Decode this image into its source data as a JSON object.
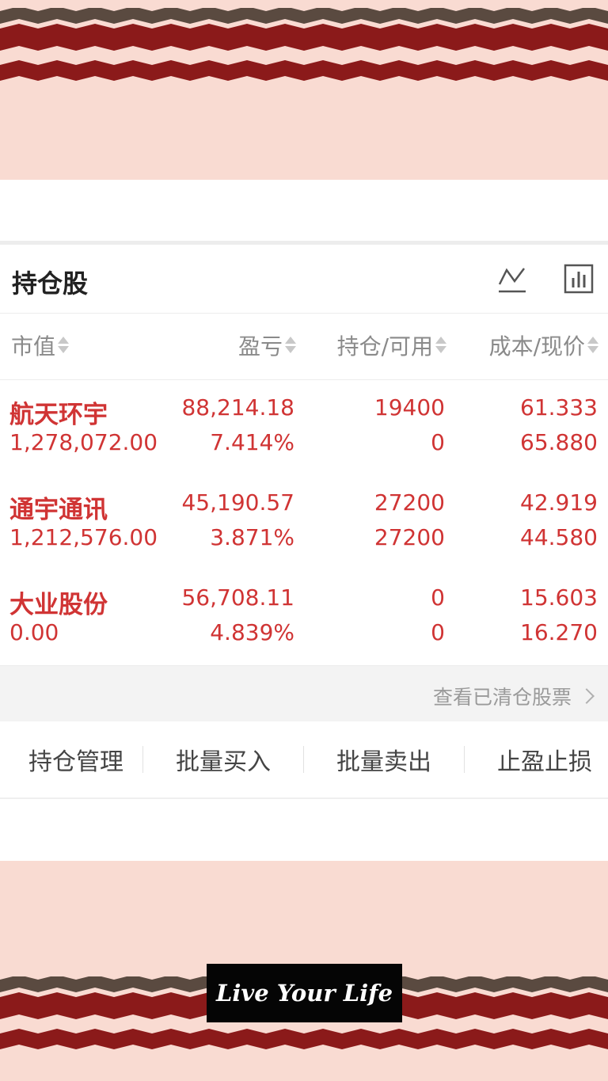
{
  "section": {
    "title": "持仓股"
  },
  "icons": {
    "trend": "line-chart-icon",
    "bars": "bar-chart-icon",
    "chevron": "chevron-right-icon"
  },
  "columns": [
    "市值",
    "盈亏",
    "持仓/可用",
    "成本/现价"
  ],
  "stocks": [
    {
      "name": "航天环宇",
      "market_value": "1,278,072.00",
      "pnl": "88,214.18",
      "pnl_pct": "7.414%",
      "position": "19400",
      "available": "0",
      "cost": "61.333",
      "price": "65.880"
    },
    {
      "name": "通宇通讯",
      "market_value": "1,212,576.00",
      "pnl": "45,190.57",
      "pnl_pct": "3.871%",
      "position": "27200",
      "available": "27200",
      "cost": "42.919",
      "price": "44.580"
    },
    {
      "name": "大业股份",
      "market_value": "0.00",
      "pnl": "56,708.11",
      "pnl_pct": "4.839%",
      "position": "0",
      "available": "0",
      "cost": "15.603",
      "price": "16.270"
    }
  ],
  "cleared_link": "查看已清仓股票",
  "actions": [
    "持仓管理",
    "批量买入",
    "批量卖出",
    "止盈止损"
  ],
  "decoration": {
    "slogan": "Live Your Life"
  },
  "colors": {
    "profit": "#d03434",
    "band_bg": "#f9dbd2",
    "stripe_dark_red": "#8b1a1a",
    "stripe_brown": "#5a4a40"
  }
}
